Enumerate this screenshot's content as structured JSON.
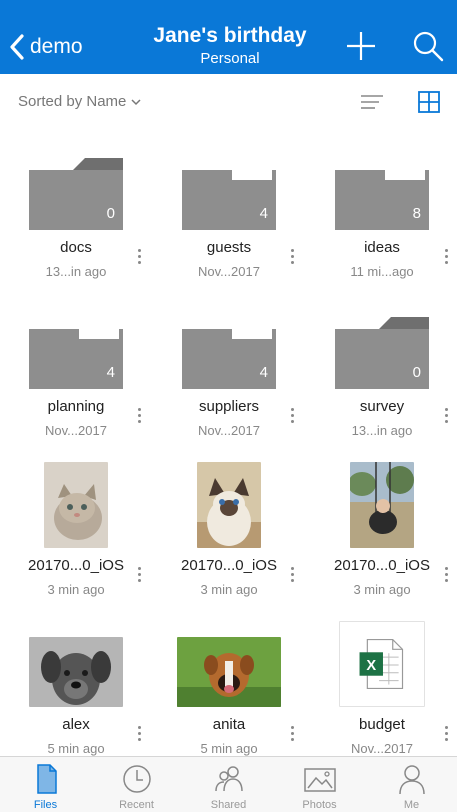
{
  "header": {
    "back_label": "demo",
    "title": "Jane's birthday",
    "subtitle": "Personal"
  },
  "toolbar": {
    "sort_label": "Sorted by Name"
  },
  "items": [
    {
      "name": "docs",
      "date": "13...in ago",
      "kind": "folder",
      "count": "0"
    },
    {
      "name": "guests",
      "date": "Nov...2017",
      "kind": "folder",
      "count": "4"
    },
    {
      "name": "ideas",
      "date": "11 mi...ago",
      "kind": "folder",
      "count": "8"
    },
    {
      "name": "planning",
      "date": "Nov...2017",
      "kind": "folder",
      "count": "4"
    },
    {
      "name": "suppliers",
      "date": "Nov...2017",
      "kind": "folder",
      "count": "4"
    },
    {
      "name": "survey",
      "date": "13...in ago",
      "kind": "folder",
      "count": "0"
    },
    {
      "name": "20170...0_iOS",
      "date": "3 min ago",
      "kind": "photo",
      "icon": "kitten-photo"
    },
    {
      "name": "20170...0_iOS",
      "date": "3 min ago",
      "kind": "photo",
      "icon": "siamese-cat-photo"
    },
    {
      "name": "20170...0_iOS",
      "date": "3 min ago",
      "kind": "photo",
      "icon": "baby-swing-photo"
    },
    {
      "name": "alex",
      "date": "5 min ago",
      "kind": "photo",
      "icon": "dog-photo"
    },
    {
      "name": "anita",
      "date": "5 min ago",
      "kind": "photo",
      "icon": "boxer-dog-photo"
    },
    {
      "name": "budget",
      "date": "Nov...2017",
      "kind": "excel",
      "icon": "excel-file-icon"
    }
  ],
  "tabs": [
    {
      "label": "Files",
      "icon": "files-icon",
      "active": true
    },
    {
      "label": "Recent",
      "icon": "clock-icon",
      "active": false
    },
    {
      "label": "Shared",
      "icon": "people-icon",
      "active": false
    },
    {
      "label": "Photos",
      "icon": "photos-icon",
      "active": false
    },
    {
      "label": "Me",
      "icon": "person-icon",
      "active": false
    }
  ],
  "colors": {
    "accent": "#0a78d7",
    "folder": "#8e8e8e",
    "excel": "#1d7245"
  }
}
